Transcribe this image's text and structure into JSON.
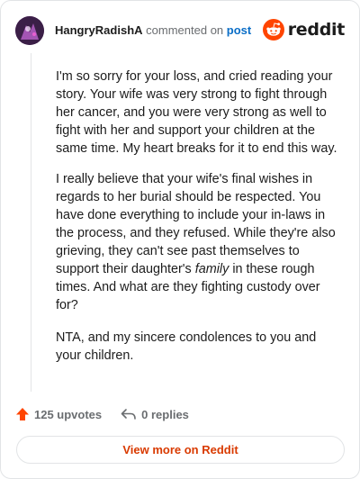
{
  "comment": {
    "author": "HangryRadishA",
    "action_text": "commented on",
    "target_link": "post",
    "paragraphs": [
      {
        "text": "I'm so sorry for your loss, and cried reading your story. Your wife was very strong to fight through her cancer, and you were very strong as well to fight with her and support your children at the same time. My heart breaks for it to end this way."
      },
      {
        "before": "I really believe that your wife's final wishes in regards to her burial should be respected. You have done everything to include your in-laws in the process, and they refused. While they're also grieving, they can't see past themselves to support their daughter's ",
        "emphasis": "family",
        "after": " in these rough times. And what are they fighting custody over for?"
      },
      {
        "text": "NTA, and my sincere condolences to you and your children."
      }
    ]
  },
  "brand": {
    "wordmark": "reddit",
    "color": "#ff4500"
  },
  "footer": {
    "upvotes_label": "125 upvotes",
    "replies_label": "0 replies",
    "view_more_label": "View more on Reddit"
  },
  "icons": {
    "avatar": "user-avatar",
    "logo": "reddit-snoo-icon",
    "upvote": "upvote-arrow-icon",
    "reply": "reply-arrow-icon"
  }
}
